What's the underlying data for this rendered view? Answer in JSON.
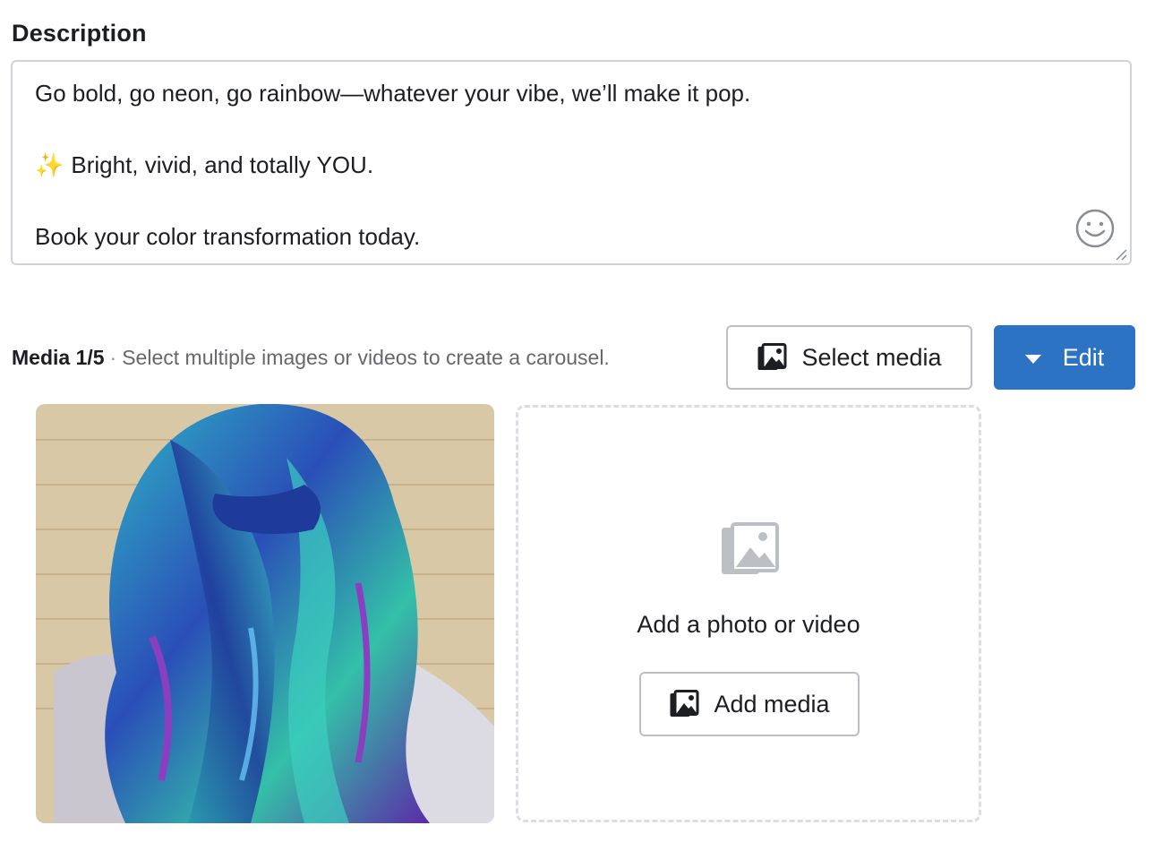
{
  "description": {
    "label": "Description",
    "lines": [
      "Go bold, go neon, go rainbow—whatever your vibe, we’ll make it pop.",
      "Bright, vivid, and totally YOU.",
      "Book your color transformation today."
    ],
    "sparkle_emoji": "✨",
    "emoji_icon": "smiley-face-icon"
  },
  "media": {
    "count_label": "Media 1/5",
    "separator": "·",
    "hint": "Select multiple images or videos to create a carousel.",
    "select_button_label": "Select media",
    "edit_button_label": "Edit",
    "dropzone_text": "Add a photo or video",
    "add_button_label": "Add media",
    "icons": {
      "select": "photo-stack-icon",
      "add": "photo-stack-icon",
      "edit_caret": "caret-down-icon",
      "dropzone": "photo-stack-icon"
    }
  },
  "colors": {
    "primary": "#2d73c3",
    "border": "#cfd3d8",
    "text": "#1c1e21",
    "muted": "#65676b"
  }
}
